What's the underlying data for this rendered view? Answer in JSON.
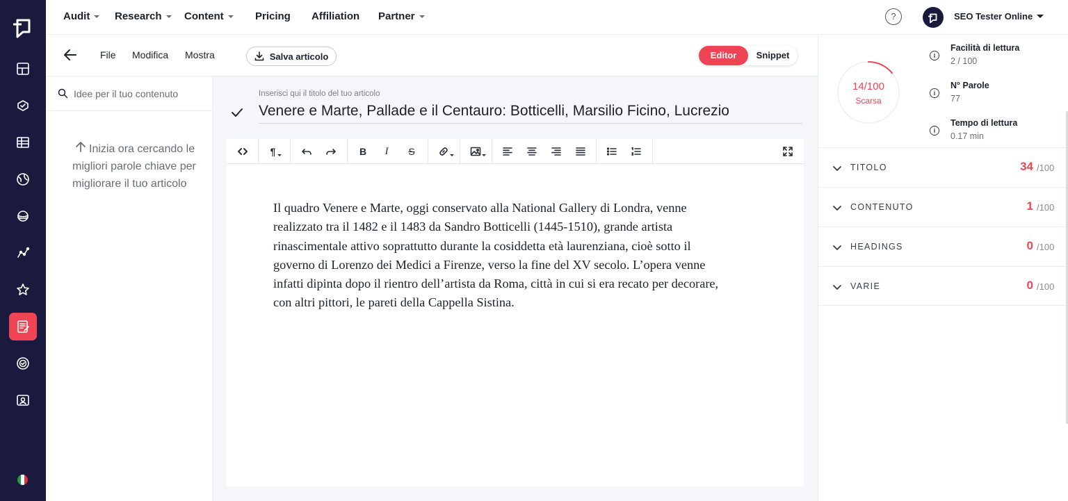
{
  "nav": {
    "items": [
      {
        "label": "Audit",
        "dropdown": true
      },
      {
        "label": "Research",
        "dropdown": true
      },
      {
        "label": "Content",
        "dropdown": true
      },
      {
        "label": "Pricing",
        "dropdown": false
      },
      {
        "label": "Affiliation",
        "dropdown": false
      },
      {
        "label": "Partner",
        "dropdown": true
      }
    ],
    "help_label": "?",
    "account_name": "SEO Tester Online"
  },
  "rail": {
    "icons": [
      "dashboard-icon",
      "audit-icon",
      "table-icon",
      "globe-icon",
      "planet-icon",
      "analytics-icon",
      "star-icon",
      "content-editor-icon",
      "badge-icon",
      "reports-icon"
    ],
    "active_icon": "content-editor-icon",
    "language": "Italiano"
  },
  "editor_header": {
    "menus": [
      "File",
      "Modifica",
      "Mostra"
    ],
    "save_label": "Salva articolo",
    "mode_editor": "Editor",
    "mode_snippet": "Snippet",
    "active_mode": "Editor"
  },
  "keywords": {
    "search_placeholder": "Idee per il tuo contenuto",
    "hint": "Inizia ora cercando le migliori parole chiave per migliorare il tuo articolo"
  },
  "article": {
    "title_hint": "Inserisci qui il titolo del tuo articolo",
    "title": "Venere e Marte, Pallade e il Centauro: Botticelli, Marsilio Ficino, Lucrezio",
    "body_lines": [
      "Il quadro Venere e Marte, oggi conservato alla National Gallery di Londra, venne",
      "realizzato tra il 1482 e il 1483 da Sandro Botticelli (1445-1510), grande artista",
      "rinascimentale attivo soprattutto durante la cosiddetta età laurenziana, cioè sotto il",
      "governo di Lorenzo dei Medici a Firenze, verso la fine del XV secolo. L’opera venne",
      "infatti dipinta dopo il rientro dell’artista da Roma, città in cui si era recato per decorare,",
      "con altri pittori, le pareti della Cappella Sistina."
    ]
  },
  "toolbar": {
    "buttons": [
      "code-view",
      "paragraph",
      "undo",
      "redo",
      "bold",
      "italic",
      "strikethrough",
      "link",
      "image",
      "align-left",
      "align-center",
      "align-right",
      "align-justify",
      "bullet-list",
      "numbered-list",
      "fullscreen"
    ],
    "bold_label": "B",
    "italic_label": "I",
    "strike_label": "S",
    "paragraph_label": "¶"
  },
  "score_panel": {
    "score": 14,
    "score_text": "14/100",
    "grade": "Scarsa",
    "accent_color": "#ef4454",
    "metrics": [
      {
        "label": "Facilità di lettura",
        "value": "2 / 100"
      },
      {
        "label": "N° Parole",
        "value": "77"
      },
      {
        "label": "Tempo di lettura",
        "value": "0.17 min"
      }
    ],
    "sections": [
      {
        "label": "TITOLO",
        "score": "34",
        "max": "/100"
      },
      {
        "label": "CONTENUTO",
        "score": "1",
        "max": "/100"
      },
      {
        "label": "HEADINGS",
        "score": "0",
        "max": "/100"
      },
      {
        "label": "VARIE",
        "score": "0",
        "max": "/100"
      }
    ]
  }
}
